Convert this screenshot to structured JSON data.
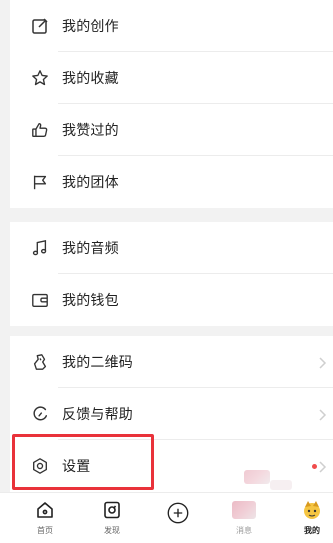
{
  "colors": {
    "highlight": "#e9323a",
    "badge_dot": "#f04c4c",
    "background": "#f2f2f2"
  },
  "menu": {
    "group1": [
      {
        "label": "我的创作",
        "icon": "edit-icon"
      },
      {
        "label": "我的收藏",
        "icon": "star-icon"
      },
      {
        "label": "我赞过的",
        "icon": "thumbs-up-icon"
      },
      {
        "label": "我的团体",
        "icon": "flag-icon"
      }
    ],
    "group2": [
      {
        "label": "我的音频",
        "icon": "music-note-icon"
      },
      {
        "label": "我的钱包",
        "icon": "wallet-icon"
      }
    ],
    "group3": [
      {
        "label": "我的二维码",
        "icon": "qr-code-icon"
      },
      {
        "label": "反馈与帮助",
        "icon": "feedback-icon"
      },
      {
        "label": "设置",
        "icon": "settings-icon"
      }
    ]
  },
  "tabbar": {
    "home": "首页",
    "discover": "发现",
    "messages": "消息",
    "me": "我的"
  }
}
